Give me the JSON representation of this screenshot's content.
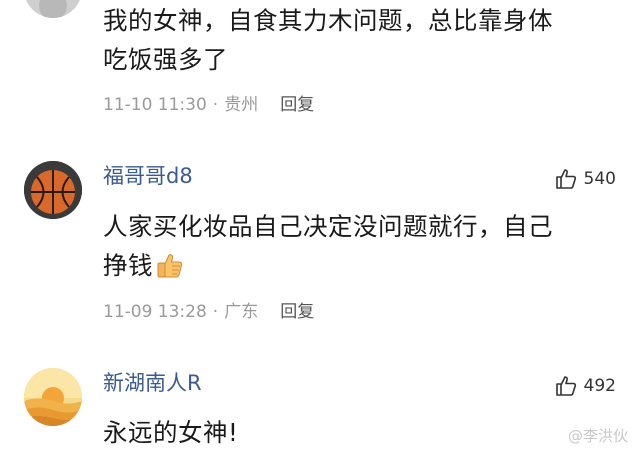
{
  "comments": [
    {
      "username": "",
      "text_line1": "我的女神，自食其力木问题，总比靠身体",
      "text_line2": "吃饭强多了",
      "time": "11-10 11:30",
      "location": "贵州",
      "reply": "回复",
      "likes": ""
    },
    {
      "username": "福哥哥d8",
      "text_line1": "人家买化妆品自己决定没问题就行，自己",
      "text_line2": "挣钱",
      "time": "11-09 13:28",
      "location": "广东",
      "reply": "回复",
      "likes": "540"
    },
    {
      "username": "新湖南人R",
      "text_line1": "永远的女神!",
      "likes": "492"
    }
  ],
  "watermark": "@李洪伙",
  "colors": {
    "username": "#3b5b8f",
    "meta": "#9a9a9a",
    "text": "#1a1a1a"
  },
  "icons": {
    "like": "thumbs-up-icon",
    "emoji": "thumbs-up-emoji"
  }
}
